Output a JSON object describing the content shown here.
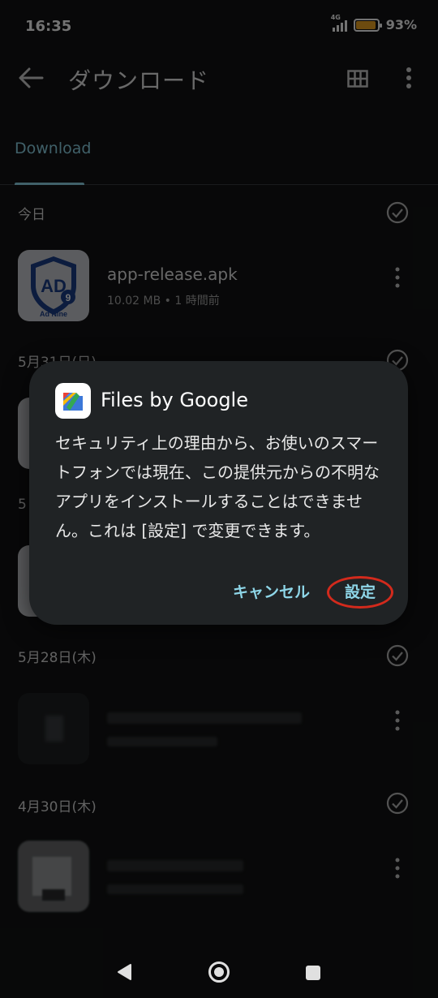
{
  "status_bar": {
    "time": "16:35",
    "network": "4G",
    "battery_percent": "93%",
    "battery_level": 0.93
  },
  "app_bar": {
    "title": "ダウンロード"
  },
  "tabs": [
    {
      "label": "Download"
    }
  ],
  "sections": [
    {
      "header": "今日",
      "items": [
        {
          "name": "app-release.apk",
          "meta": "10.02 MB • 1 時間前",
          "thumb": "adnine-app-icon"
        }
      ]
    },
    {
      "header": "5月31日(日)",
      "items": []
    },
    {
      "header": "5月28日(木)",
      "items": []
    },
    {
      "header": "4月30日(木)",
      "items": []
    }
  ],
  "dialog": {
    "app_name": "Files by Google",
    "body": "セキュリティ上の理由から、お使いのスマートフォンでは現在、この提供元からの不明なアプリをインストールすることはできません。これは [設定] で変更できます。",
    "cancel_label": "キャンセル",
    "settings_label": "設定",
    "highlight_color": "#d32a1c"
  },
  "colors": {
    "accent": "#8ed6e8",
    "background": "#121314",
    "dialog": "#202325"
  },
  "navbar": {
    "icons": [
      "back-triangle-icon",
      "home-circle-icon",
      "recents-square-icon"
    ]
  }
}
